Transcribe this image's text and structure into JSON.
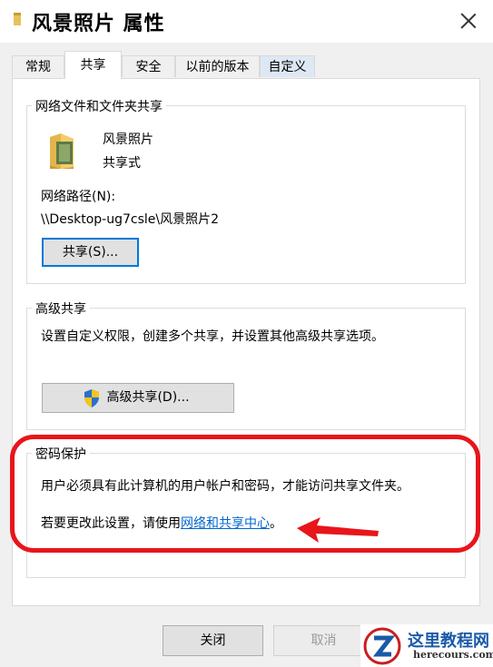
{
  "window": {
    "title": "风景照片 属性",
    "icons": {
      "folder": "folder-icon",
      "close": "close-icon"
    }
  },
  "tabs": [
    {
      "label": "常规"
    },
    {
      "label": "共享",
      "active": true
    },
    {
      "label": "安全"
    },
    {
      "label": "以前的版本"
    },
    {
      "label": "自定义"
    }
  ],
  "network_sharing": {
    "group_title": "网络文件和文件夹共享",
    "folder_name": "风景照片",
    "share_status": "共享式",
    "path_label": "网络路径(N):",
    "path_value": "\\\\Desktop-ug7csle\\风景照片2",
    "share_button": "共享(S)..."
  },
  "advanced_sharing": {
    "group_title": "高级共享",
    "description": "设置自定义权限，创建多个共享，并设置其他高级共享选项。",
    "button": "高级共享(D)...",
    "button_icon": "shield-icon"
  },
  "password_protection": {
    "group_title": "密码保护",
    "description": "用户必须具有此计算机的用户帐户和密码，才能访问共享文件夹。",
    "change_prefix": "若要更改此设置，请使用",
    "link_text": "网络和共享中心",
    "change_suffix": "。"
  },
  "footer": {
    "close_button": "关闭",
    "cancel_button": "取消"
  },
  "watermark": {
    "name": "这里教程网",
    "url": "herecours.com"
  },
  "annotation": {
    "color": "#e8151b"
  }
}
